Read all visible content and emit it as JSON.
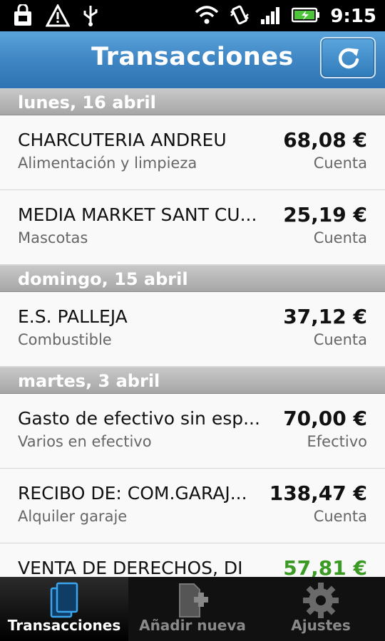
{
  "status_bar": {
    "time": "9:15",
    "icons": [
      "shopping-bag-icon",
      "warning-icon",
      "usb-icon",
      "wifi-icon",
      "vibrate-icon",
      "signal-icon",
      "battery-icon"
    ]
  },
  "header": {
    "title": "Transacciones",
    "refresh_icon": "refresh-icon"
  },
  "sections": [
    {
      "date": "lunes, 16 abril",
      "items": [
        {
          "merchant": "CHARCUTERIA ANDREU",
          "category": "Alimentación y limpieza",
          "amount": "68,08 €",
          "account": "Cuenta"
        },
        {
          "merchant": "MEDIA MARKET SANT CU...",
          "category": "Mascotas",
          "amount": "25,19 €",
          "account": "Cuenta"
        }
      ]
    },
    {
      "date": "domingo, 15 abril",
      "items": [
        {
          "merchant": "E.S. PALLEJA",
          "category": "Combustible",
          "amount": "37,12 €",
          "account": "Cuenta"
        }
      ]
    },
    {
      "date": "martes, 3 abril",
      "items": [
        {
          "merchant": "Gasto de efectivo sin esp...",
          "category": "Varios en efectivo",
          "amount": "70,00 €",
          "account": "Efectivo"
        },
        {
          "merchant": "RECIBO DE: COM.GARAJ...",
          "category": "Alquiler garaje",
          "amount": "138,47 €",
          "account": "Cuenta"
        },
        {
          "merchant": "VENTA DE DERECHOS, DI",
          "category": "",
          "amount": "57,81 €",
          "account": ""
        }
      ]
    }
  ],
  "nav": {
    "tabs": [
      {
        "label": "Transacciones",
        "icon": "documents-icon",
        "active": true
      },
      {
        "label": "Añadir nueva",
        "icon": "add-document-icon",
        "active": false
      },
      {
        "label": "Ajustes",
        "icon": "gear-icon",
        "active": false
      }
    ]
  },
  "colors": {
    "accent": "#3f86c4",
    "positive": "#3a9a24"
  }
}
